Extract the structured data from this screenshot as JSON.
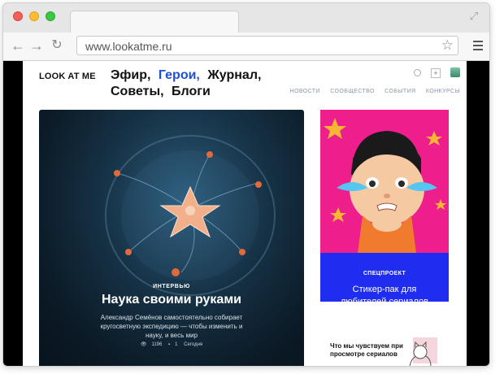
{
  "browser": {
    "url": "www.lookatme.ru"
  },
  "site": {
    "logo": "LOOK AT ME",
    "nav": [
      "Эфир,",
      "Герои,",
      "Журнал,",
      "Советы,",
      "Блоги"
    ],
    "subnav": [
      "НОВОСТИ",
      "СООБЩЕСТВО",
      "СОБЫТИЯ",
      "КОНКУРСЫ"
    ]
  },
  "hero": {
    "kicker": "ИНТЕРВЬЮ",
    "title": "Наука своими руками",
    "description": "Александр Семёнов самостоятельно собирает кругосветную экспедицию — чтобы изменить и науку, и весь мир",
    "views": "1196",
    "comments": "1",
    "date": "Сегодня"
  },
  "promo": {
    "label": "СПЕЦПРОЕКТ",
    "title": "Стикер-пак для любителей сериалов"
  },
  "card2": {
    "title": "Что мы чувствуем при просмотре сериалов"
  }
}
